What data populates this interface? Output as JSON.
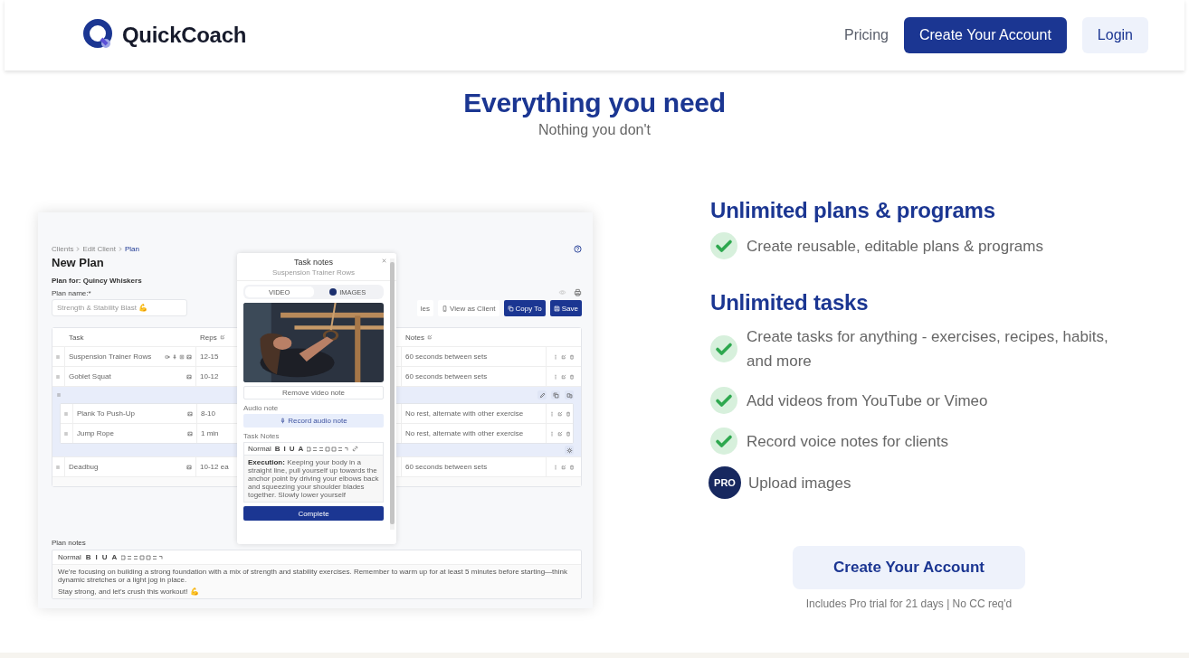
{
  "header": {
    "logo": "QuickCoach",
    "nav": [
      {
        "label": "Pricing",
        "kind": "link"
      },
      {
        "label": "Create Your Account",
        "kind": "primary"
      },
      {
        "label": "Login",
        "kind": "secondary"
      }
    ]
  },
  "hero": {
    "title": "Everything you need",
    "subtitle": "Nothing you don't"
  },
  "app": {
    "breadcrumb": [
      {
        "label": "Clients",
        "selected": false
      },
      {
        "label": "Edit Client",
        "selected": false
      },
      {
        "label": "Plan",
        "selected": true
      }
    ],
    "title": "New Plan",
    "plan_for": "Plan for: Quincy Whiskers",
    "plan_name_label": "Plan name:*",
    "plan_name_value": "Strength & Stability Blast 💪",
    "actions": [
      {
        "label": "les",
        "kind": "outline"
      },
      {
        "label": "View as Client",
        "kind": "outline"
      },
      {
        "label": "Copy To",
        "kind": "primary"
      },
      {
        "label": "Save",
        "kind": "primary"
      }
    ],
    "table": {
      "columns": [
        "Task",
        "Reps",
        "Notes"
      ],
      "rows": [
        {
          "kind": "task",
          "task": "Suspension Trainer Rows",
          "has_media": true,
          "reps": "12-15",
          "notes": "60 seconds between sets"
        },
        {
          "kind": "task",
          "task": "Goblet Squat",
          "has_media": false,
          "reps": "10-12",
          "notes": "60 seconds between sets"
        },
        {
          "kind": "group",
          "children": [
            {
              "kind": "task",
              "task": "Plank To Push-Up",
              "has_media": false,
              "reps": "8-10",
              "notes": "No rest, alternate with other exercise"
            },
            {
              "kind": "task",
              "task": "Jump Rope",
              "has_media": false,
              "reps": "1 min",
              "notes": "No rest, alternate with other exercise"
            }
          ]
        },
        {
          "kind": "task",
          "task": "Deadbug",
          "has_media": false,
          "reps": "10-12 ea",
          "notes": "60 seconds between sets"
        }
      ]
    },
    "modal": {
      "title": "Task notes",
      "subtitle": "Suspension Trainer Rows",
      "tabs": [
        {
          "label": "VIDEO",
          "selected": true,
          "pro": false
        },
        {
          "label": "IMAGES",
          "selected": false,
          "pro": true
        }
      ],
      "remove_button": "Remove video note",
      "audio_label": "Audio note",
      "record_button": "Record audio note",
      "notes_label": "Task Notes",
      "style": "Normal",
      "format_buttons": [
        "B",
        "I",
        "U",
        "A"
      ],
      "notes": "**Execution:** Keeping your body in a straight line, pull yourself up towards the anchor point by driving your elbows back and squeezing your shoulder blades together. Slowly lower yourself",
      "complete_button": "Complete"
    },
    "plan_notes": {
      "label": "Plan notes",
      "style": "Normal",
      "format_buttons": [
        "B",
        "I",
        "U",
        "A"
      ],
      "lines": [
        "We're focusing on building a strong foundation with a mix of strength and stability exercises. Remember to warm up for at least 5 minutes before starting—think dynamic stretches or a light jog in place.",
        "Stay strong, and let's crush this workout! 💪"
      ]
    }
  },
  "features": [
    {
      "title": "Unlimited plans & programs",
      "items": [
        {
          "kind": "check",
          "text": "Create reusable, editable plans & programs"
        }
      ]
    },
    {
      "title": "Unlimited tasks",
      "items": [
        {
          "kind": "check",
          "text": "Create tasks for anything - exercises, recipes, habits, and more"
        },
        {
          "kind": "check",
          "text": "Add videos from YouTube or Vimeo"
        },
        {
          "kind": "check",
          "text": "Record voice notes for clients"
        },
        {
          "kind": "pro",
          "badge": "PRO",
          "text": "Upload images"
        }
      ]
    }
  ],
  "cta": {
    "button": "Create Your Account",
    "note": "Includes Pro trial for 21 days | No CC req'd"
  }
}
